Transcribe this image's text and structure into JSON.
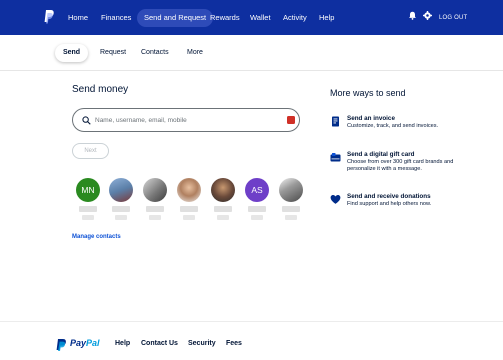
{
  "nav": {
    "items": [
      "Home",
      "Finances",
      "Send and Request",
      "Rewards",
      "Wallet",
      "Activity",
      "Help"
    ],
    "active": "Send and Request",
    "logout": "LOG OUT"
  },
  "subnav": {
    "items": [
      "Send",
      "Request",
      "Contacts",
      "More"
    ],
    "active": "Send"
  },
  "send": {
    "heading": "Send money",
    "search_placeholder": "Name, username, email, mobile",
    "next_label": "Next"
  },
  "contacts": [
    {
      "initials": "MN",
      "color": "#2a8a20",
      "photo": false
    },
    {
      "initials": "",
      "color": "#5b7fa8",
      "photo": true
    },
    {
      "initials": "",
      "color": "#7a7a7a",
      "photo": true
    },
    {
      "initials": "",
      "color": "#b08060",
      "photo": true
    },
    {
      "initials": "",
      "color": "#6b4a3a",
      "photo": true
    },
    {
      "initials": "AS",
      "color": "#6e3fc8",
      "photo": false
    },
    {
      "initials": "",
      "color": "#9a9a9a",
      "photo": true
    }
  ],
  "manage_contacts": "Manage contacts",
  "more_ways": {
    "heading": "More ways to send",
    "items": [
      {
        "title": "Send an invoice",
        "desc": "Customize, track, and send invoices.",
        "icon": "invoice-icon"
      },
      {
        "title": "Send a digital gift card",
        "desc": "Choose from over 300 gift card brands and personalize it with a message.",
        "icon": "gift-card-icon"
      },
      {
        "title": "Send and receive donations",
        "desc": "Find support and help others now.",
        "icon": "donation-heart-icon"
      }
    ]
  },
  "footer": {
    "brand_pay": "Pay",
    "brand_pal": "Pal",
    "links": [
      "Help",
      "Contact Us",
      "Security",
      "Fees"
    ]
  },
  "colors": {
    "nav_bg": "#0e2fa0",
    "accent_link": "#0e52d6",
    "icon_blue": "#002c8a"
  }
}
